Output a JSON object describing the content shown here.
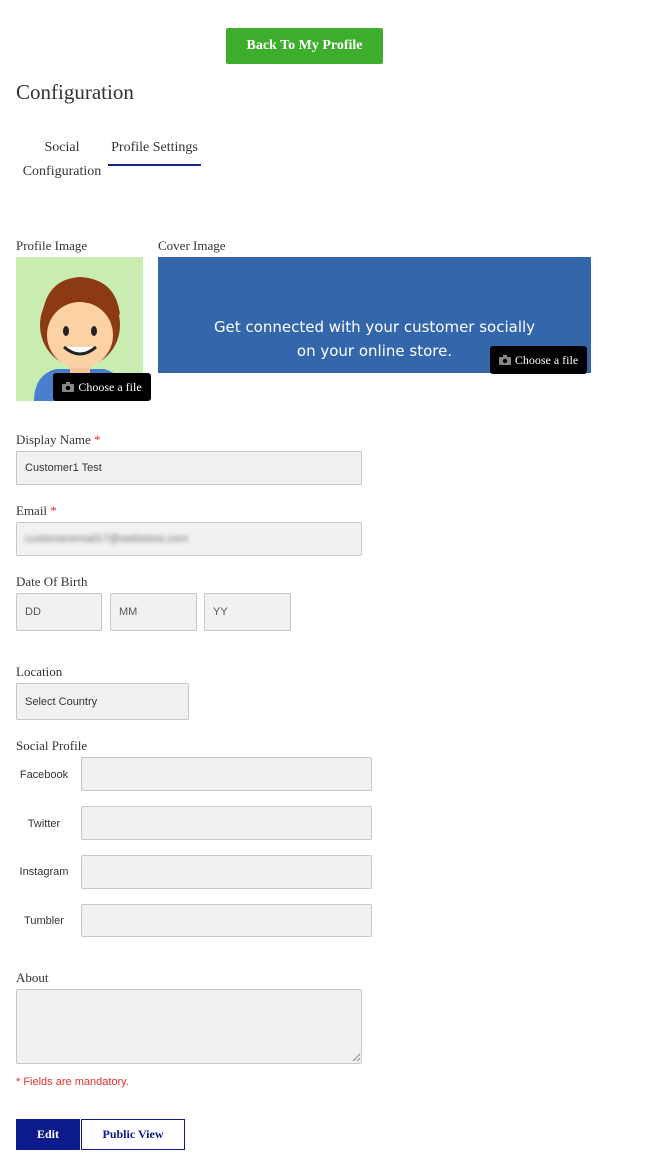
{
  "header": {
    "back_label": "Back To My Profile",
    "title": "Configuration"
  },
  "tabs": [
    {
      "label": "Social Configuration",
      "line1": "Social",
      "line2": "Configuration",
      "active": false
    },
    {
      "label": "Profile Settings",
      "active": true
    }
  ],
  "images": {
    "profile_label": "Profile Image",
    "cover_label": "Cover Image",
    "cover_line1": "Get connected with your customer socially",
    "cover_line2": "on your online store.",
    "choose_label": "Choose a file"
  },
  "form": {
    "display_name": {
      "label": "Display Name",
      "required_mark": "*",
      "value": "Customer1 Test"
    },
    "email": {
      "label": "Email",
      "required_mark": "*",
      "value": "customeremail17@webstore.com"
    },
    "dob": {
      "label": "Date Of Birth",
      "dd": "DD",
      "mm": "MM",
      "yy": "YY"
    },
    "location": {
      "label": "Location",
      "value": "Select Country"
    },
    "social": {
      "label": "Social Profile",
      "facebook": "Facebook",
      "twitter": "Twitter",
      "instagram": "Instagram",
      "tumbler": "Tumbler"
    },
    "about": {
      "label": "About",
      "value": ""
    },
    "mandatory_note": "* Fields are mandatory."
  },
  "actions": {
    "edit": "Edit",
    "public_view": "Public View"
  },
  "colors": {
    "accent_green": "#3dae2b",
    "primary_blue": "#0d1a8c",
    "cover_blue": "#3366aa",
    "required_red": "#e03030"
  },
  "icons": [
    "camera-icon"
  ]
}
